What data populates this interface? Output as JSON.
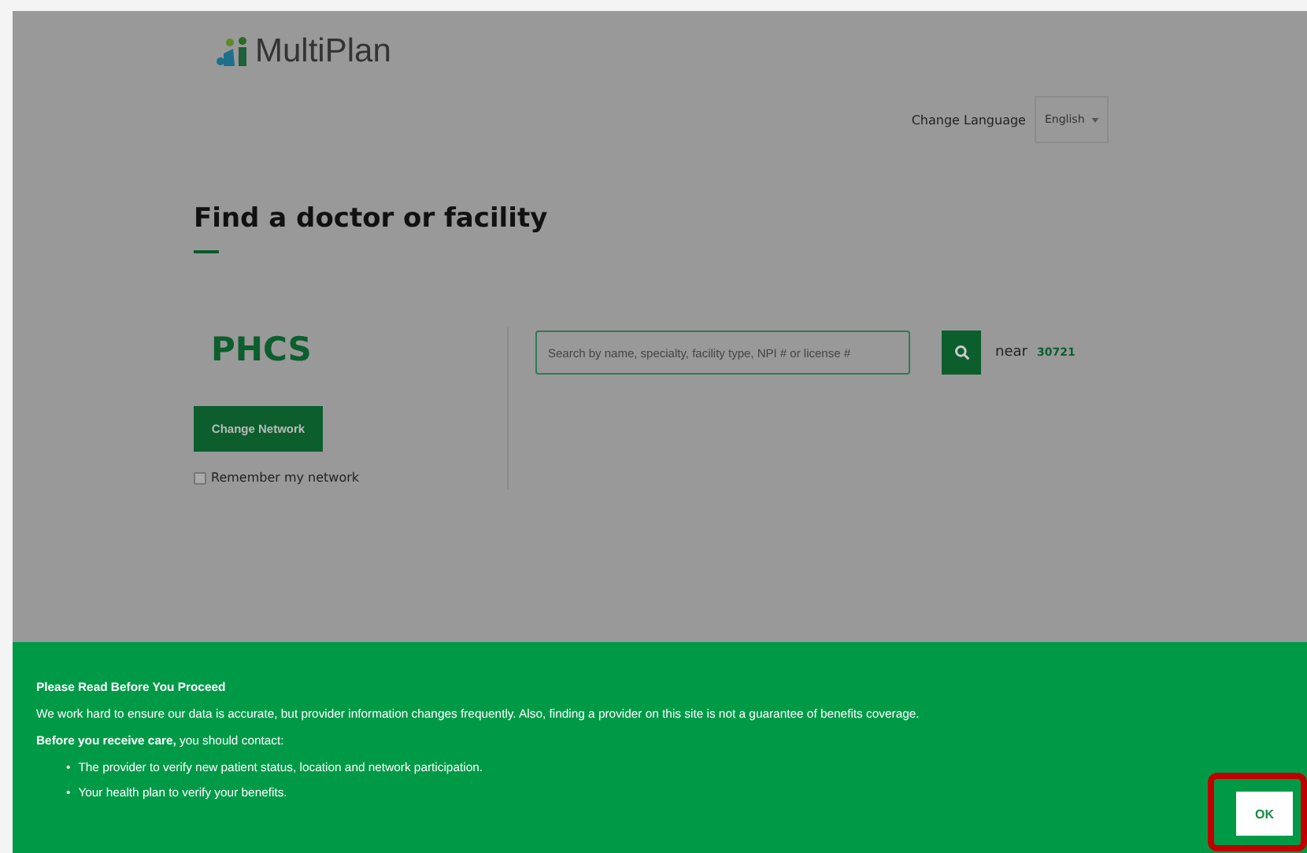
{
  "logo": {
    "text": "MultiPlan"
  },
  "language": {
    "label": "Change Language",
    "value": "English"
  },
  "title": "Find a doctor or facility",
  "network": {
    "name": "PHCS",
    "button": "Change Network",
    "remember": {
      "label": "Remember my network",
      "checked": false
    }
  },
  "search": {
    "placeholder": "Search by name, specialty, facility type, NPI # or license #",
    "near_label": "near",
    "zip": "30721"
  },
  "notice": {
    "heading": "Please Read Before You Proceed",
    "paragraph": "We work hard to ensure our data is accurate, but provider information changes frequently. Also, finding a provider on this site is not a guarantee of benefits coverage.",
    "contact": "**Before you receive care,** you should contact:",
    "bullets": [
      {
        "marker": "•",
        "text": "The provider to verify new patient status, location and network participation."
      },
      {
        "marker": "•",
        "text": "Your health plan to verify your benefits."
      }
    ],
    "button": "OK"
  }
}
